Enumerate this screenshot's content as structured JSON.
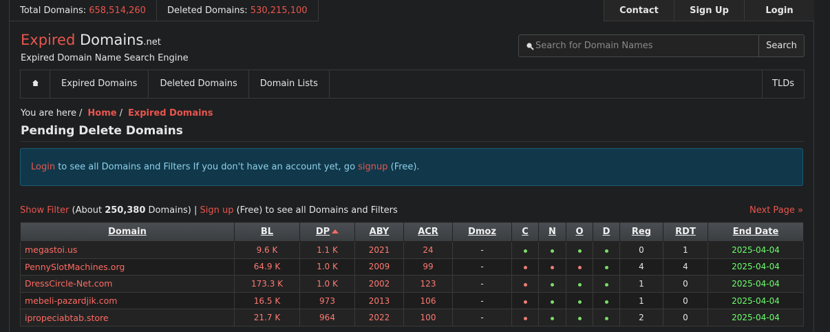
{
  "topbar": {
    "total_label": "Total Domains:",
    "total_value": "658,514,260",
    "deleted_label": "Deleted Domains:",
    "deleted_value": "530,215,100"
  },
  "usernav": {
    "contact": "Contact",
    "signup": "Sign Up",
    "login": "Login"
  },
  "logo": {
    "part1": "Expired",
    "part2": "Domains",
    "part3": ".net",
    "tagline": "Expired Domain Name Search Engine"
  },
  "search": {
    "placeholder": "Search for Domain Names",
    "button": "Search",
    "icon": "search-icon"
  },
  "mainnav": {
    "home_icon": "home-icon",
    "items": [
      "Expired Domains",
      "Deleted Domains",
      "Domain Lists"
    ],
    "tlds": "TLDs"
  },
  "breadcrumb": {
    "prefix": "You are here",
    "home": "Home",
    "current": "Expired Domains"
  },
  "page_title": "Pending Delete Domains",
  "alert": {
    "login": "Login",
    "text1": " to see all Domains and Filters If you don't have an account yet, go ",
    "signup": "signup",
    "text2": " (Free)."
  },
  "filterbar": {
    "show_filter": "Show Filter",
    "about_pre": " (About ",
    "count": "250,380",
    "about_post": " Domains) | ",
    "signup": "Sign up",
    "rest": " (Free) to see all Domains and Filters",
    "next": "Next Page »"
  },
  "table": {
    "columns": [
      "Domain",
      "BL",
      "DP",
      "ABY",
      "ACR",
      "Dmoz",
      "C",
      "N",
      "O",
      "D",
      "Reg",
      "RDT",
      "End Date"
    ],
    "rows": [
      {
        "domain": "megastoi.us",
        "bl": "9.6 K",
        "dp": "1.1 K",
        "aby": "2021",
        "acr": "24",
        "dmoz": "-",
        "c": "g",
        "n": "g",
        "o": "g",
        "d": "g",
        "reg": "0",
        "rdt": "1",
        "end": "2025-04-04"
      },
      {
        "domain": "PennySlotMachines.org",
        "bl": "64.9 K",
        "dp": "1.0 K",
        "aby": "2009",
        "acr": "99",
        "dmoz": "-",
        "c": "r",
        "n": "r",
        "o": "r",
        "d": "g",
        "reg": "4",
        "rdt": "4",
        "end": "2025-04-04"
      },
      {
        "domain": "DressCircle-Net.com",
        "bl": "173.3 K",
        "dp": "1.0 K",
        "aby": "2002",
        "acr": "123",
        "dmoz": "-",
        "c": "r",
        "n": "g",
        "o": "g",
        "d": "g",
        "reg": "1",
        "rdt": "0",
        "end": "2025-04-04"
      },
      {
        "domain": "mebeli-pazardjik.com",
        "bl": "16.5 K",
        "dp": "973",
        "aby": "2013",
        "acr": "106",
        "dmoz": "-",
        "c": "r",
        "n": "g",
        "o": "g",
        "d": "g",
        "reg": "1",
        "rdt": "0",
        "end": "2025-04-04"
      },
      {
        "domain": "ipropeciabtab.store",
        "bl": "21.7 K",
        "dp": "964",
        "aby": "2022",
        "acr": "100",
        "dmoz": "-",
        "c": "r",
        "n": "g",
        "o": "g",
        "d": "g",
        "reg": "2",
        "rdt": "0",
        "end": "2025-04-04"
      }
    ]
  }
}
